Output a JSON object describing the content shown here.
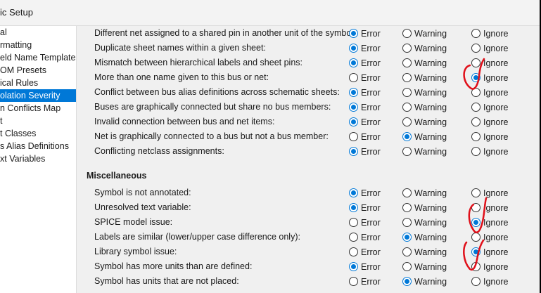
{
  "window": {
    "title": "ic Setup"
  },
  "sidebar": {
    "items": [
      {
        "label": "al",
        "selected": false
      },
      {
        "label": "rmatting",
        "selected": false
      },
      {
        "label": "eld Name Templates",
        "selected": false
      },
      {
        "label": "OM Presets",
        "selected": false
      },
      {
        "label": "ical Rules",
        "selected": false
      },
      {
        "label": "olation Severity",
        "selected": true
      },
      {
        "label": "n Conflicts Map",
        "selected": false
      },
      {
        "label": "t",
        "selected": false
      },
      {
        "label": "t Classes",
        "selected": false
      },
      {
        "label": "s Alias Definitions",
        "selected": false
      },
      {
        "label": "xt Variables",
        "selected": false
      }
    ]
  },
  "options": {
    "error": "Error",
    "warning": "Warning",
    "ignore": "Ignore"
  },
  "rules_top": [
    {
      "label": "Different net assigned to a shared pin in another unit of the symbol:",
      "selected": "error"
    },
    {
      "label": "Duplicate sheet names within a given sheet:",
      "selected": "error"
    },
    {
      "label": "Mismatch between hierarchical labels and sheet pins:",
      "selected": "error"
    },
    {
      "label": "More than one name given to this bus or net:",
      "selected": "ignore"
    },
    {
      "label": "Conflict between bus alias definitions across schematic sheets:",
      "selected": "error"
    },
    {
      "label": "Buses are graphically connected but share no bus members:",
      "selected": "error"
    },
    {
      "label": "Invalid connection between bus and net items:",
      "selected": "error"
    },
    {
      "label": "Net is graphically connected to a bus but not a bus member:",
      "selected": "warning"
    },
    {
      "label": "Conflicting netclass assignments:",
      "selected": "error"
    }
  ],
  "misc_section": {
    "heading": "Miscellaneous",
    "rules": [
      {
        "label": "Symbol is not annotated:",
        "selected": "error"
      },
      {
        "label": "Unresolved text variable:",
        "selected": "error"
      },
      {
        "label": "SPICE model issue:",
        "selected": "ignore"
      },
      {
        "label": "Labels are similar (lower/upper case difference only):",
        "selected": "warning"
      },
      {
        "label": "Library symbol issue:",
        "selected": "ignore"
      },
      {
        "label": "Symbol has more units than are defined:",
        "selected": "error"
      },
      {
        "label": "Symbol has units that are not placed:",
        "selected": "warning"
      }
    ]
  },
  "annotation_color": "#e0101a"
}
